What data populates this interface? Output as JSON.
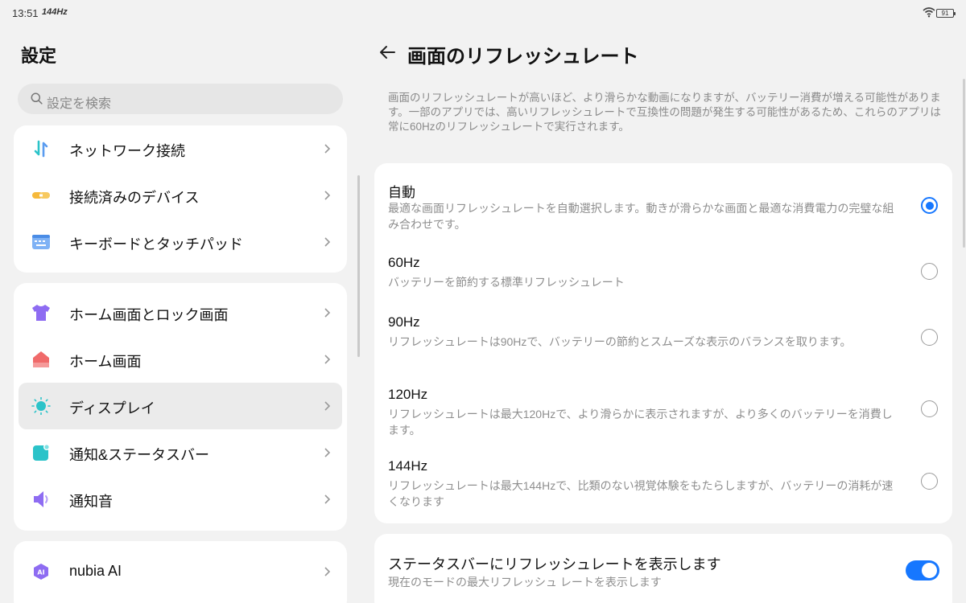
{
  "status_bar": {
    "time": "13:51",
    "refresh_rate": "144Hz",
    "battery": "91"
  },
  "left": {
    "title": "設定",
    "search_placeholder": "設定を検索",
    "group1": [
      {
        "label": "ネットワーク接続",
        "icon": "network-transfer-icon"
      },
      {
        "label": "接続済みのデバイス",
        "icon": "linked-devices-icon"
      },
      {
        "label": "キーボードとタッチパッド",
        "icon": "keyboard-icon"
      }
    ],
    "group2": [
      {
        "label": "ホーム画面とロック画面",
        "icon": "shirt-theme-icon"
      },
      {
        "label": "ホーム画面",
        "icon": "home-icon"
      },
      {
        "label": "ディスプレイ",
        "icon": "sun-display-icon",
        "selected": true
      },
      {
        "label": "通知&ステータスバー",
        "icon": "notification-icon"
      },
      {
        "label": "通知音",
        "icon": "speaker-icon"
      }
    ],
    "group3": [
      {
        "label": "nubia AI",
        "icon": "ai-icon"
      }
    ]
  },
  "right": {
    "title": "画面のリフレッシュレート",
    "description": "画面のリフレッシュレートが高いほど、より滑らかな動画になりますが、バッテリー消費が増える可能性があります。一部のアプリでは、高いリフレッシュレートで互換性の問題が発生する可能性があるため、これらのアプリは常に60Hzのリフレッシュレートで実行されます。",
    "options": [
      {
        "title": "自動",
        "desc": "最適な画面リフレッシュレートを自動選択します。動きが滑らかな画面と最適な消費電力の完璧な組み合わせです。",
        "selected": true
      },
      {
        "title": "60Hz",
        "desc": "バッテリーを節約する標準リフレッシュレート",
        "selected": false
      },
      {
        "title": "90Hz",
        "desc": "リフレッシュレートは90Hzで、バッテリーの節約とスムーズな表示のバランスを取ります。",
        "selected": false
      },
      {
        "title": "120Hz",
        "desc": "リフレッシュレートは最大120Hzで、より滑らかに表示されますが、より多くのバッテリーを消費します。",
        "selected": false
      },
      {
        "title": "144Hz",
        "desc": "リフレッシュレートは最大144Hzで、比類のない視覚体験をもたらしますが、バッテリーの消耗が速くなります",
        "selected": false
      }
    ],
    "statusbar_toggle": {
      "title": "ステータスバーにリフレッシュレートを表示します",
      "desc": "現在のモードの最大リフレッシュ レートを表示します",
      "on": true
    }
  },
  "colors": {
    "accent": "#1677ff",
    "background": "#f2f2f2",
    "card": "#ffffff",
    "selected_row": "#ebebeb"
  }
}
